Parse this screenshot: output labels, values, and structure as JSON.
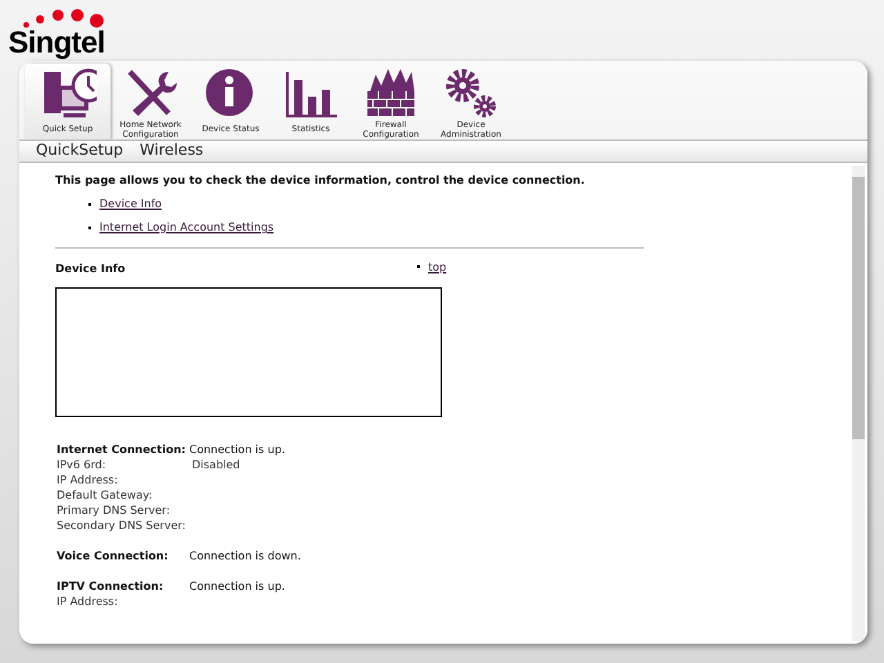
{
  "logo": {
    "text": "Singtel"
  },
  "nav_tabs": [
    {
      "label": "Quick Setup",
      "kind": "computer",
      "selected": true
    },
    {
      "label": "Home Network Configuration",
      "kind": "tools",
      "selected": false
    },
    {
      "label": "Device Status",
      "kind": "info",
      "selected": false
    },
    {
      "label": "Statistics",
      "kind": "bars",
      "selected": false
    },
    {
      "label": "Firewall Configuration",
      "kind": "firewall",
      "selected": false
    },
    {
      "label": "Device Administration",
      "kind": "gears",
      "selected": false
    }
  ],
  "sub_menu": [
    "QuickSetup",
    "Wireless"
  ],
  "intro": "This page allows you to check the device information, control the device connection.",
  "links": [
    "Device Info",
    "Internet Login Account Settings"
  ],
  "section": {
    "title": "Device Info",
    "top_link": "top"
  },
  "groups": [
    {
      "title": "Internet Connection:",
      "status": "Connection is up.",
      "rows": [
        {
          "label": "IPv6 6rd:",
          "value": "Disabled"
        },
        {
          "label": "IP Address:"
        },
        {
          "label": "Default Gateway:"
        },
        {
          "label": "Primary DNS Server:"
        },
        {
          "label": "Secondary DNS Server:"
        }
      ]
    },
    {
      "title": "Voice Connection:",
      "status": "Connection is down."
    },
    {
      "title": "IPTV Connection:",
      "status": "Connection is up.",
      "rows": [
        {
          "label": "IP Address:"
        }
      ]
    }
  ]
}
